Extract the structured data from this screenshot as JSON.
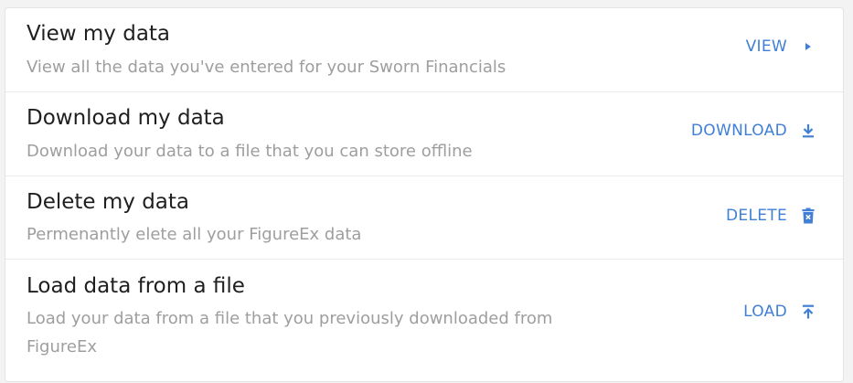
{
  "items": [
    {
      "title": "View my data",
      "description": "View all the data you've entered for your Sworn Financials",
      "action_label": "VIEW",
      "action_icon": "caret-right-icon"
    },
    {
      "title": "Download my data",
      "description": "Download your data to a file that you can store offline",
      "action_label": "DOWNLOAD",
      "action_icon": "download-icon"
    },
    {
      "title": "Delete my data",
      "description": "Permenantly elete all your FigureEx data",
      "action_label": "DELETE",
      "action_icon": "trash-icon"
    },
    {
      "title": "Load data from a file",
      "description_line1": "Load your data from a file that you previously downloaded from",
      "description_line2": "FigureEx",
      "action_label": "LOAD",
      "action_icon": "upload-icon"
    }
  ],
  "colors": {
    "accent": "#3f7fd6",
    "title": "#1f1f1f",
    "description": "#9e9e9e",
    "divider": "#ececec"
  }
}
